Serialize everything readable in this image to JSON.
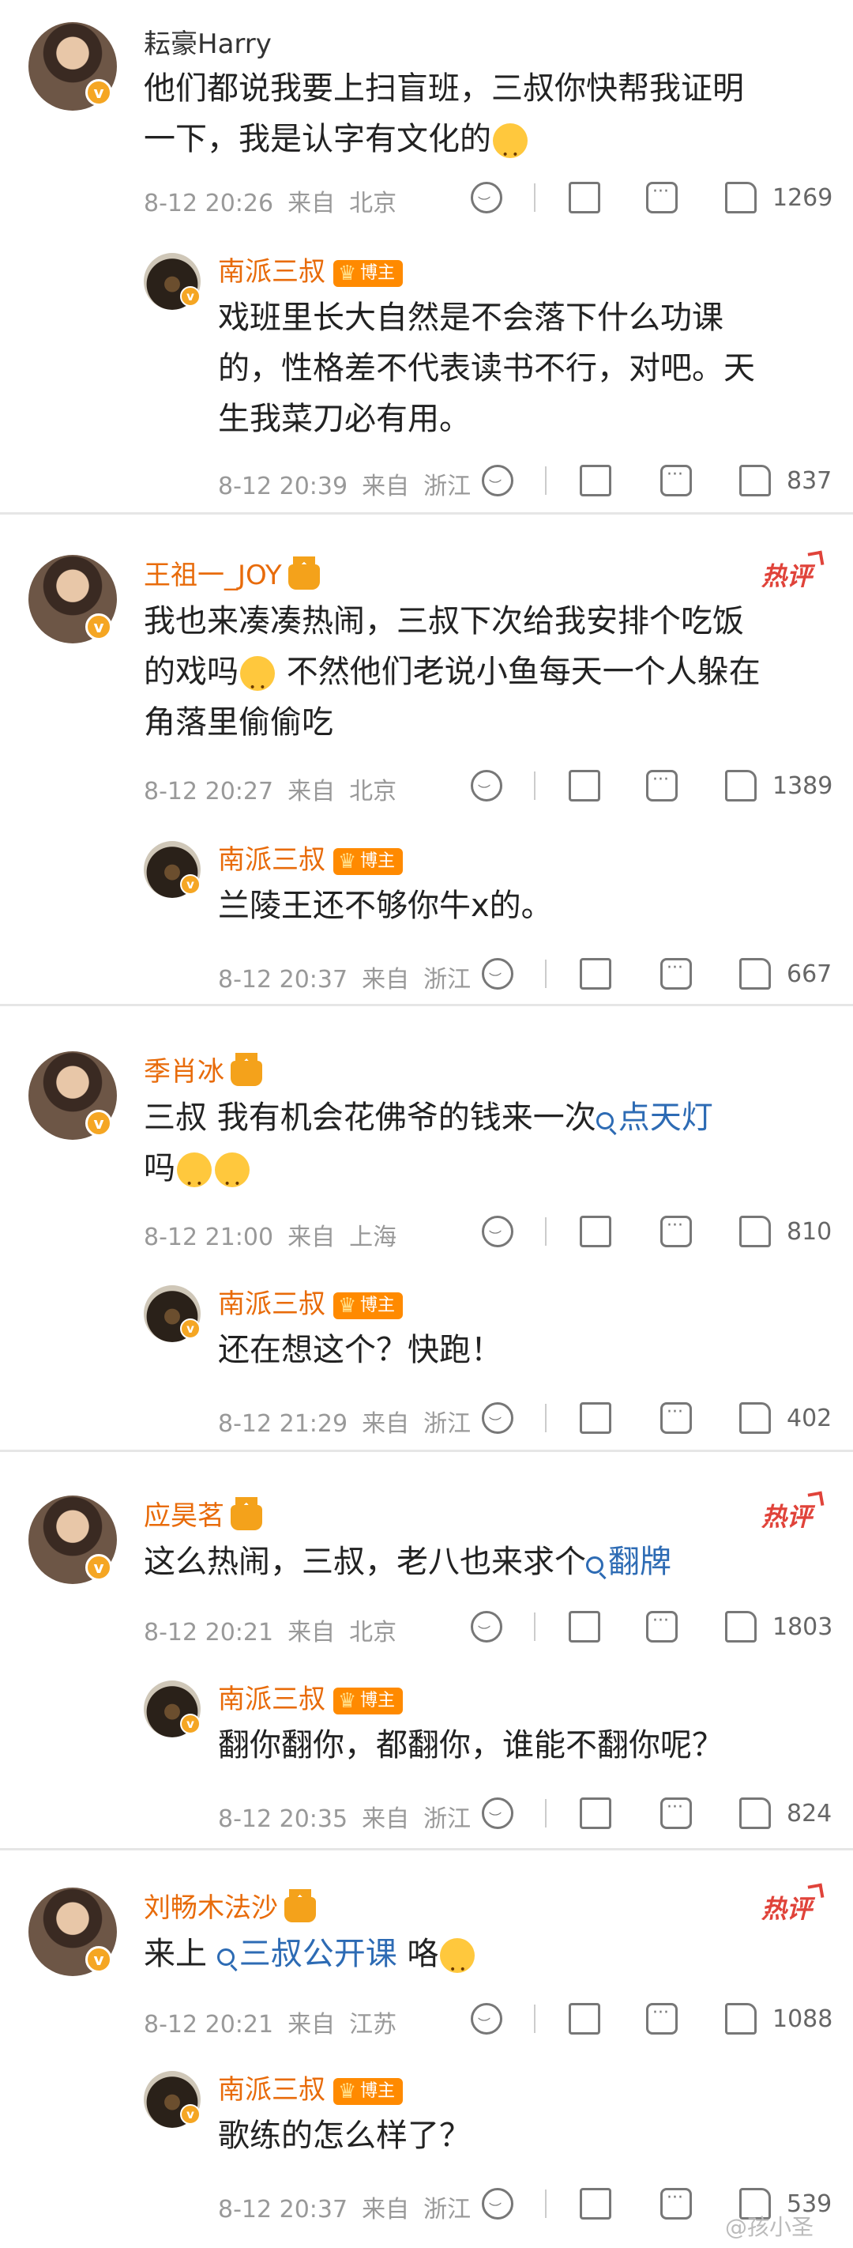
{
  "comments": [
    {
      "user": "耘豪Harry",
      "text_lines": [
        "他们都说我要上扫盲班，三叔你快帮我证明",
        "一下，我是认字有文化的"
      ],
      "time": "8-12 20:26",
      "from": "来自",
      "location": "北京",
      "likes": "1269",
      "hot": "",
      "reply": {
        "user": "南派三叔",
        "badge": "博主",
        "text_lines": [
          "戏班里长大自然是不会落下什么功课",
          "的，性格差不代表读书不行，对吧。天",
          "生我菜刀必有用。"
        ],
        "time": "8-12 20:39",
        "from": "来自",
        "location": "浙江",
        "likes": "837"
      }
    },
    {
      "user": "王祖一_JOY",
      "text_lines": [
        "我也来凑凑热闹，三叔下次给我安排个吃饭",
        "的戏吗",
        "不然他们老说小鱼每天一个人躲在",
        "角落里偷偷吃"
      ],
      "time": "8-12 20:27",
      "from": "来自",
      "location": "北京",
      "likes": "1389",
      "hot": "热评",
      "reply": {
        "user": "南派三叔",
        "badge": "博主",
        "text_lines": [
          "兰陵王还不够你牛x的。"
        ],
        "time": "8-12 20:37",
        "from": "来自",
        "location": "浙江",
        "likes": "667"
      }
    },
    {
      "user": "季肖冰",
      "text_lines": [
        "三叔 我有机会花佛爷的钱来一次",
        "点天灯",
        "吗"
      ],
      "time": "8-12 21:00",
      "from": "来自",
      "location": "上海",
      "likes": "810",
      "hot": "",
      "reply": {
        "user": "南派三叔",
        "badge": "博主",
        "text_lines": [
          "还在想这个？快跑！"
        ],
        "time": "8-12 21:29",
        "from": "来自",
        "location": "浙江",
        "likes": "402"
      }
    },
    {
      "user": "应昊茗",
      "text_lines": [
        "这么热闹，三叔，老八也来求个",
        "翻牌"
      ],
      "time": "8-12 20:21",
      "from": "来自",
      "location": "北京",
      "likes": "1803",
      "hot": "热评",
      "reply": {
        "user": "南派三叔",
        "badge": "博主",
        "text_lines": [
          "翻你翻你，都翻你，谁能不翻你呢？"
        ],
        "time": "8-12 20:35",
        "from": "来自",
        "location": "浙江",
        "likes": "824"
      }
    },
    {
      "user": "刘畅木法沙",
      "text_lines": [
        "来上",
        "三叔公开课",
        "咯"
      ],
      "time": "8-12 20:21",
      "from": "来自",
      "location": "江苏",
      "likes": "1088",
      "hot": "热评",
      "reply": {
        "user": "南派三叔",
        "badge": "博主",
        "text_lines": [
          "歌练的怎么样了？"
        ],
        "time": "8-12 20:37",
        "from": "来自",
        "location": "浙江",
        "likes": "539"
      }
    }
  ],
  "watermark": "@孩小圣"
}
